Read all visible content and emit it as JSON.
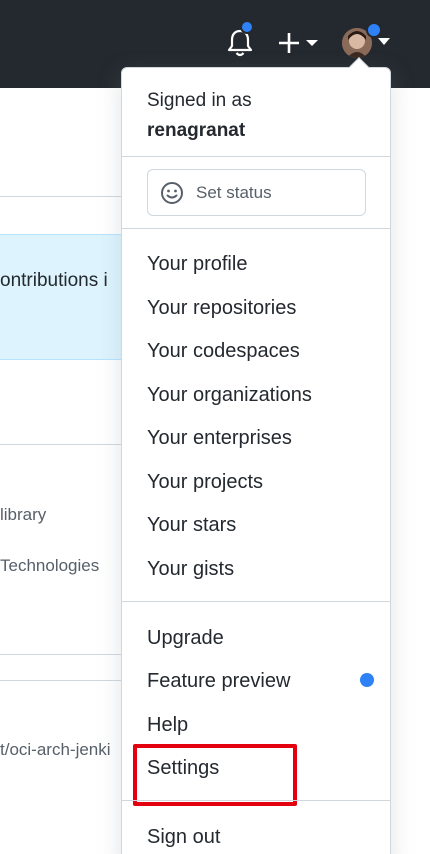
{
  "header": {
    "bell_icon": "bell-icon",
    "plus_icon": "plus-icon",
    "avatar_label": "user-avatar",
    "notification_dot_color": "#2f81f7"
  },
  "background": {
    "banner_text": "ontributions i",
    "row1_text": "library",
    "row2_text": "Technologies",
    "row3_text": "t/oci-arch-jenki"
  },
  "menu": {
    "signed_in_as": "Signed in as",
    "username": "renagranat",
    "set_status": "Set status",
    "items": [
      {
        "label": "Your profile"
      },
      {
        "label": "Your repositories"
      },
      {
        "label": "Your codespaces"
      },
      {
        "label": "Your organizations"
      },
      {
        "label": "Your enterprises"
      },
      {
        "label": "Your projects"
      },
      {
        "label": "Your stars"
      },
      {
        "label": "Your gists"
      }
    ],
    "secondary": [
      {
        "label": "Upgrade"
      },
      {
        "label": "Feature preview"
      },
      {
        "label": "Help"
      },
      {
        "label": "Settings"
      }
    ],
    "sign_out": "Sign out"
  },
  "highlight_color": "#e3000f"
}
